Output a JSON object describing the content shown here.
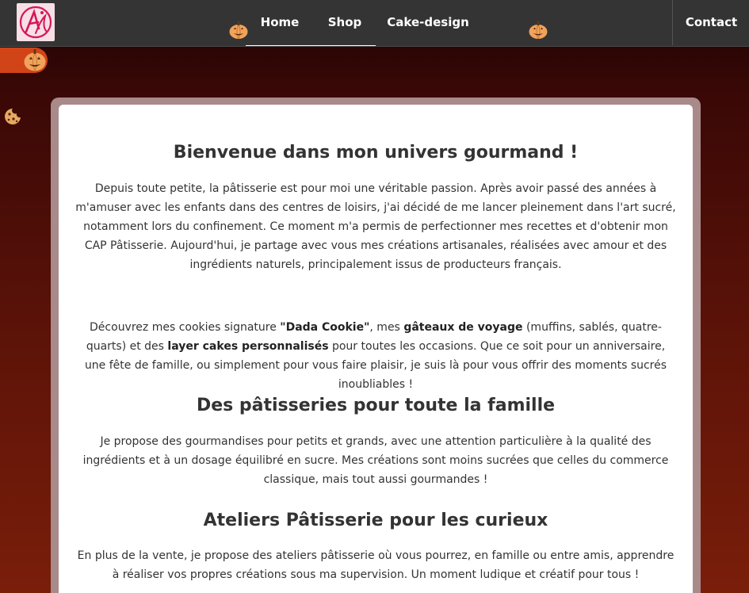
{
  "nav": {
    "home": "Home",
    "shop": "Shop",
    "cake_design": "Cake-design",
    "contact": "Contact"
  },
  "colors": {
    "nav_bg": "#343434",
    "logo_bg": "#f7dfe6",
    "logo_accent": "#d4165a",
    "pill": "#d04418",
    "pumpkin": "#f0a35a"
  },
  "icons": {
    "logo": "aa-monogram-logo",
    "pumpkin": "pumpkin-icon",
    "cookie": "cookie-icon"
  },
  "content": {
    "welcome_title": "Bienvenue dans mon univers gourmand !",
    "intro_text": "Depuis toute petite, la pâtisserie est pour moi une véritable passion. Après avoir passé des années à m'amuser avec les enfants dans des centres de loisirs, j'ai décidé de me lancer pleinement dans l'art sucré, notamment lors du confinement. Ce moment m'a permis de perfectionner mes recettes et d'obtenir mon CAP Pâtisserie. Aujourd'hui, je partage avec vous mes créations artisanales, réalisées avec amour et des ingrédients naturels, principalement issus de producteurs français.",
    "cookies_part1": "Découvrez mes cookies signature ",
    "cookies_bold1": "\"Dada Cookie\"",
    "cookies_part2": ", mes ",
    "cookies_bold2": "gâteaux de voyage",
    "cookies_part3": " (muffins, sablés, quatre-quarts) et des ",
    "cookies_bold3": "layer cakes personnalisés",
    "cookies_part4": " pour toutes les occasions. Que ce soit pour un anniversaire, une fête de famille, ou simplement pour vous faire plaisir, je suis là pour vous offrir des moments sucrés inoubliables !",
    "family_title": "Des pâtisseries pour toute la famille",
    "family_text": "Je propose des gourmandises pour petits et grands, avec une attention particulière à la qualité des ingrédients et à un dosage équilibré en sucre. Mes créations sont moins sucrées que celles du commerce classique, mais tout aussi gourmandes !",
    "ateliers_title": "Ateliers Pâtisserie pour les curieux",
    "ateliers_text": "En plus de la vente, je propose des ateliers pâtisserie où vous pourrez, en famille ou entre amis, apprendre à réaliser vos propres créations sous ma supervision. Un moment ludique et créatif pour tous !"
  }
}
